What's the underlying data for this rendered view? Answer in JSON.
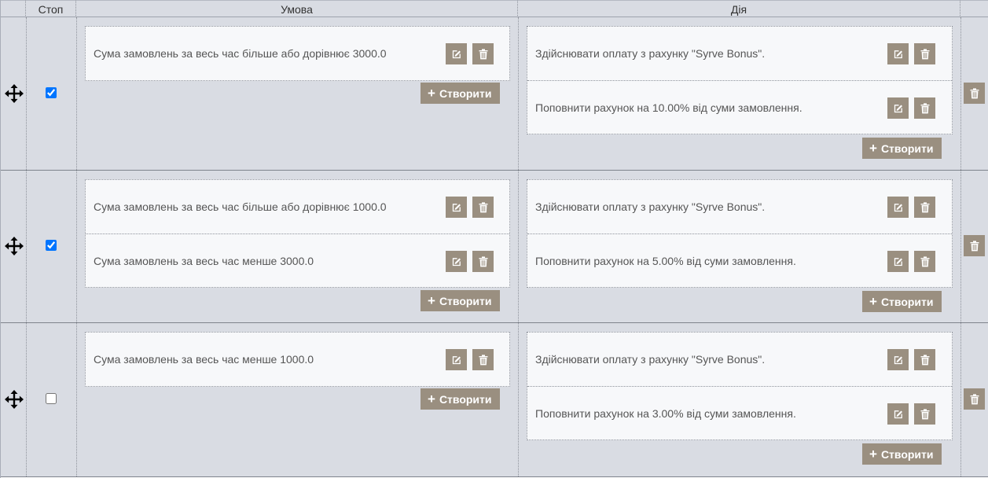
{
  "header": {
    "stop": "Стоп",
    "condition": "Умова",
    "action": "Дія"
  },
  "create_label": "Створити",
  "icons": {
    "move": "move-arrows-icon",
    "edit": "edit-icon",
    "delete": "trash-icon"
  },
  "colors": {
    "button": "#9a8f80",
    "row_bg": "#d9dce3",
    "block_bg": "#f7f8fa"
  },
  "rules": [
    {
      "stop": true,
      "conditions": [
        "Сума замовлень за весь час більше або дорівнює 3000.0"
      ],
      "actions": [
        "Здійснювати оплату з рахунку \"Syrve Bonus\".",
        "Поповнити рахунок на 10.00% від суми замовлення."
      ]
    },
    {
      "stop": true,
      "conditions": [
        "Сума замовлень за весь час більше або дорівнює 1000.0",
        "Сума замовлень за весь час менше 3000.0"
      ],
      "actions": [
        "Здійснювати оплату з рахунку \"Syrve Bonus\".",
        "Поповнити рахунок на 5.00% від суми замовлення."
      ]
    },
    {
      "stop": false,
      "conditions": [
        "Сума замовлень за весь час менше 1000.0"
      ],
      "actions": [
        "Здійснювати оплату з рахунку \"Syrve Bonus\".",
        "Поповнити рахунок на 3.00% від суми замовлення."
      ]
    }
  ]
}
